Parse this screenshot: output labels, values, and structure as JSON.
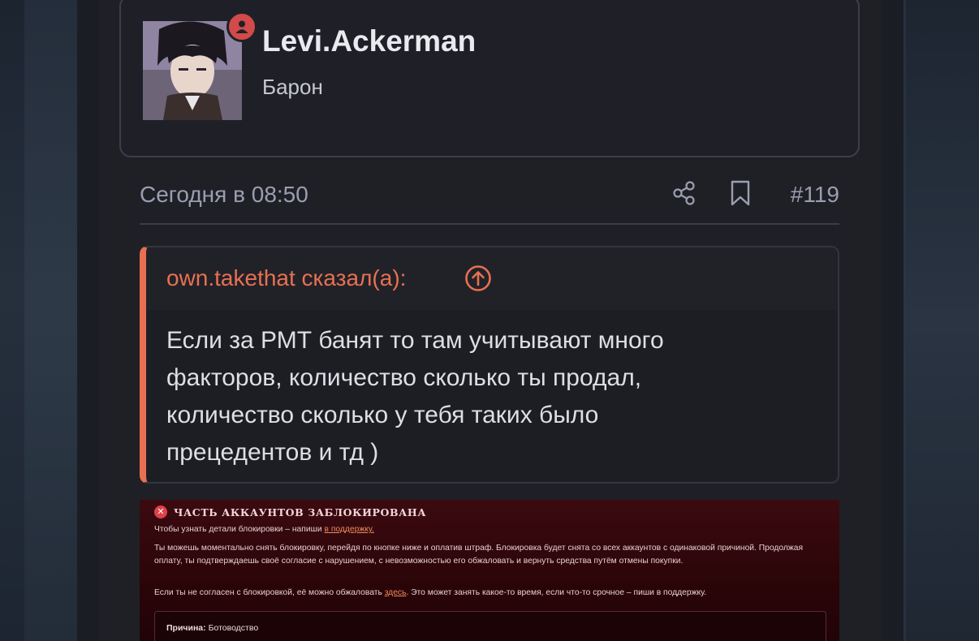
{
  "user": {
    "name": "Levi.Ackerman",
    "title": "Барон"
  },
  "post": {
    "date": "Сегодня в 08:50",
    "number": "#119"
  },
  "quote": {
    "author": "own.takethat сказал(а):",
    "lines": [
      "Если за РМТ банят то там учитывают много",
      "факторов, количество сколько ты продал,",
      "количество сколько у тебя таких было",
      "прецедентов и тд )"
    ]
  },
  "screenshot": {
    "title": "ЧАСТЬ АККАУНТОВ ЗАБЛОКИРОВАНА",
    "p1_text": "Чтобы узнать детали блокировки – напиши ",
    "p1_link": "в поддержку.",
    "p2": "Ты можешь моментально снять блокировку, перейдя по кнопке ниже и оплатив штраф. Блокировка будет снята со всех аккаунтов с одинаковой причиной. Продолжая оплату, ты подтверждаешь своё согласие с нарушением, с невозможностью его обжаловать и вернуть средства путём отмены покупки.",
    "p3_before": "Если ты не согласен с блокировкой, её можно обжаловать ",
    "p3_link": "здесь",
    "p3_after": ". Это может занять какое-то время, если что-то срочное – пиши в поддержку.",
    "reason_label": "Причина:",
    "reason_value": " Ботоводство"
  },
  "colors": {
    "accent": "#e87050",
    "background": "#1f2026",
    "badge": "#d24a4a"
  },
  "icons": [
    "person-icon",
    "share-icon",
    "bookmark-icon",
    "arrow-up-circle-icon",
    "close-circle-icon"
  ]
}
